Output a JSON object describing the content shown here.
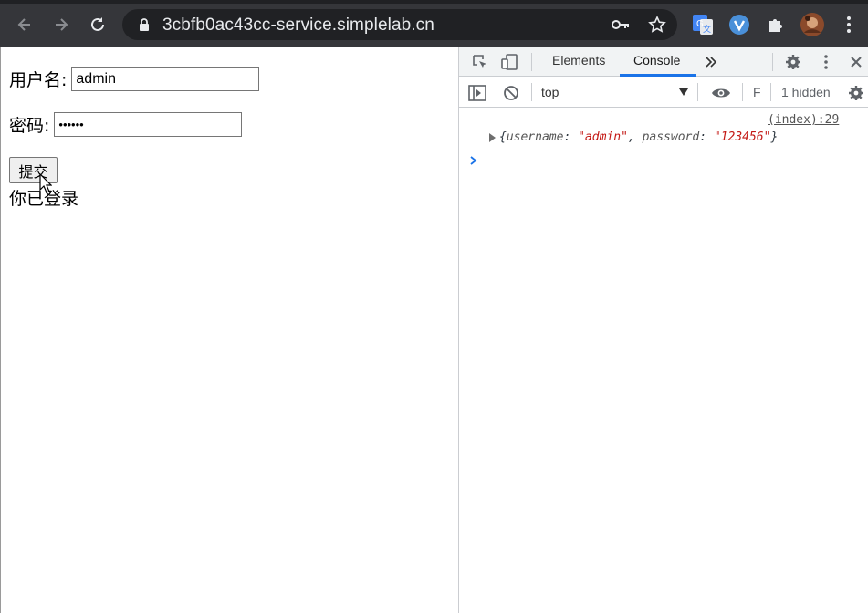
{
  "browser": {
    "url": "3cbfb0ac43cc-service.simplelab.cn"
  },
  "page": {
    "username_label": "用户名:",
    "username_value": "admin",
    "password_label": "密码:",
    "password_value": "••••••",
    "submit_label": "提交",
    "status_text": "你已登录"
  },
  "devtools": {
    "tabs": [
      "Elements",
      "Console"
    ],
    "active_tab": "Console",
    "context": "top",
    "filter_placeholder": "F",
    "hidden_count": "1 hidden",
    "console": {
      "source_link": "(index):29",
      "log_open": "{",
      "log_key1": "username",
      "log_val1": "\"admin\"",
      "log_key2": "password",
      "log_val2": "\"123456\"",
      "log_close": "}"
    }
  },
  "colors": {
    "chrome_bg": "#35363a",
    "omnibox_bg": "#202124",
    "accent": "#1a73e8",
    "string_red": "#c41a16"
  }
}
